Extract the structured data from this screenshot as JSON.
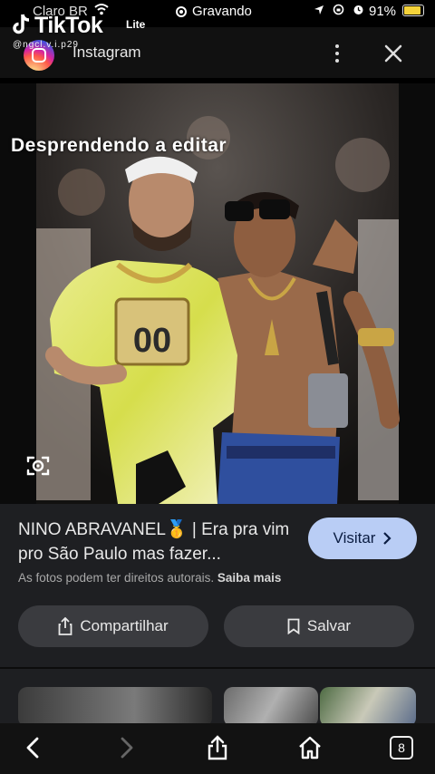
{
  "status_bar": {
    "carrier": "Claro BR",
    "recording": "Gravando",
    "battery_percent": "91%",
    "battery_level": 0.91
  },
  "watermark": {
    "brand": "TikTok",
    "variant": "Lite",
    "username": "@ngcl.v.i.p29"
  },
  "header": {
    "site": "Instagram"
  },
  "image": {
    "caption": "Desprendendo a editar",
    "jersey_number": "00"
  },
  "result": {
    "title": "NINO ABRAVANEL🥇 | Era pra vim pro São Paulo mas fazer...",
    "visit_label": "Visitar",
    "rights_text": "As fotos podem ter direitos autorais.",
    "rights_link": "Saiba mais",
    "share_label": "Compartilhar",
    "save_label": "Salvar"
  },
  "toolbar": {
    "tab_count": "8"
  },
  "colors": {
    "visit_button": "#b9cdf5",
    "panel_bg": "#1e1f22",
    "action_button_bg": "#3a3b3f",
    "battery_fill": "#f5d33a"
  },
  "icons": {
    "header": [
      "instagram-icon",
      "more-options-icon",
      "close-icon"
    ],
    "image": [
      "lens-search-icon"
    ],
    "toolbar": [
      "back-icon",
      "forward-icon",
      "share-icon",
      "home-icon",
      "tabs-icon"
    ]
  }
}
